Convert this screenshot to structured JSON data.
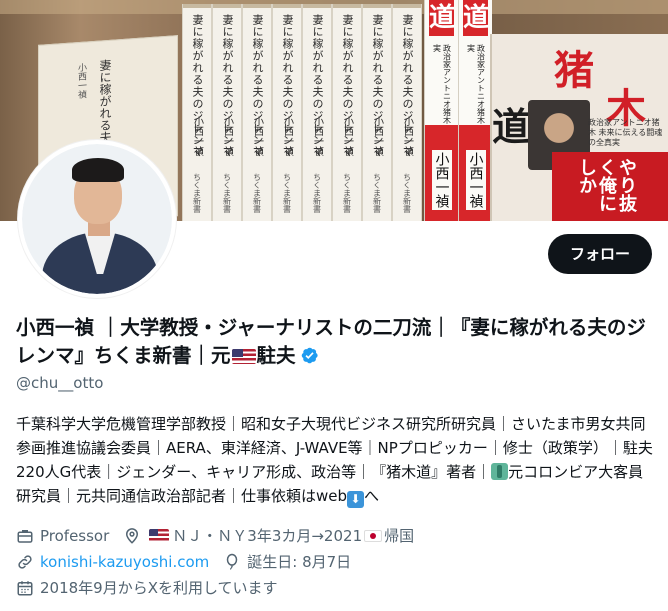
{
  "banner": {
    "spine_title": "妻に稼がれる夫のジレンマ",
    "spine_author": "小西一禎",
    "spine_publisher": "ちくま新書",
    "cover_left_title": "妻に稼がれる夫のジレンマ",
    "cover_left_author": "小西一禎",
    "red_book_kanji": "道",
    "red_book_sub": "政治家アントニオ猪木 未来に伝える闘魂の全真実",
    "red_book_author": "小西一禎",
    "big_cover_k1": "猪",
    "big_cover_k2": "木",
    "big_cover_k3": "道",
    "big_cover_red": "やり抜く俺にしか",
    "big_cover_sub": "政治家アントニオ猪木 未来に伝える闘魂の全真実"
  },
  "follow_button": {
    "label": "フォロー"
  },
  "profile": {
    "name_part1": "小西一禎 ｜大学教授・ジャーナリストの二刀流｜『妻に稼がれる夫のジレンマ』ちくま新書｜元",
    "name_part2": "駐夫",
    "handle": "@chu__otto",
    "bio_line1": "千葉科学大学危機管理学部教授｜昭和女子大現代ビジネス研究所研究員｜さいたま市男女共同参画推進協議会委員｜AERA、東洋経済、J-WAVE等｜NPプロピッカー｜修士（政策学）｜駐夫220人G代表｜ジェンダー、キャリア形成、政治等｜『猪木道』著者｜",
    "bio_line2": "元コロンビア大客員研究員｜元共同通信政治部記者｜仕事依頼はweb",
    "bio_line3": "へ"
  },
  "meta": {
    "profession": "Professor",
    "location_part1": "ＮＪ・ＮＹ3年3カ月→2021",
    "location_part2": "帰国",
    "website": "konishi-kazuyoshi.com",
    "birthday": "誕生日: 8月7日",
    "joined": "2018年9月からXを利用しています"
  },
  "colors": {
    "text_primary": "#0f1419",
    "text_secondary": "#536471",
    "link": "#1d9bf0",
    "verified": "#1d9bf0",
    "button_bg": "#0f1419"
  },
  "icons": [
    "briefcase-icon",
    "location-pin-icon",
    "link-icon",
    "balloon-icon",
    "calendar-icon",
    "verified-badge-icon"
  ]
}
